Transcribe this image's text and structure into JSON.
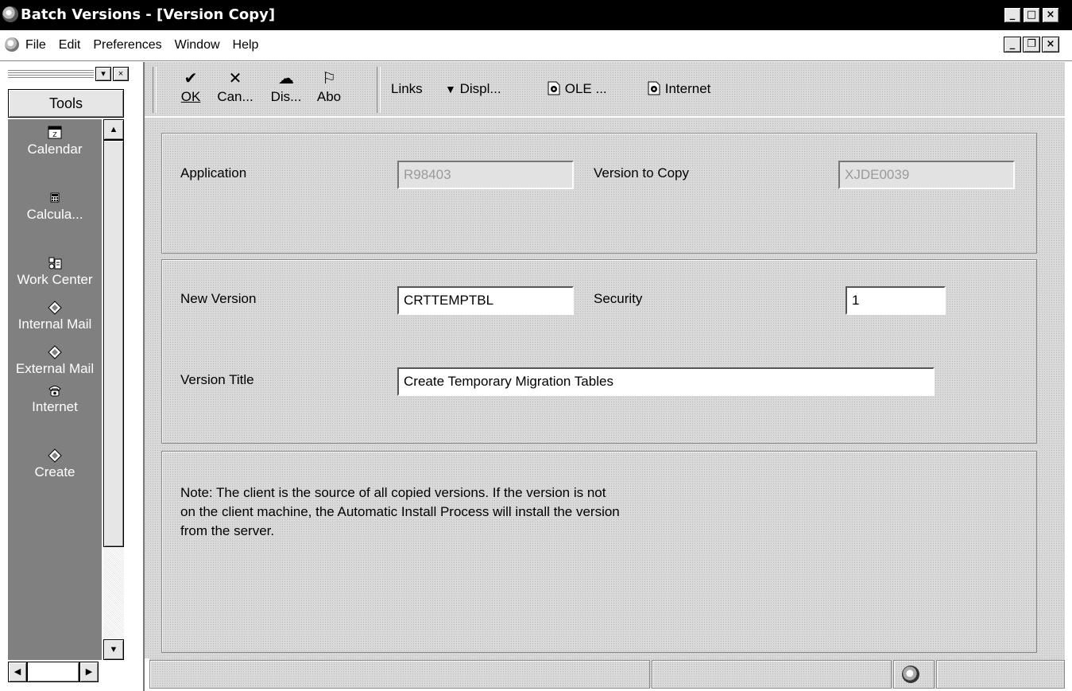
{
  "window": {
    "title": "Batch Versions - [Version Copy]"
  },
  "menu": [
    "File",
    "Edit",
    "Preferences",
    "Window",
    "Help"
  ],
  "tools_pane": {
    "header": "Tools",
    "items": [
      {
        "label": "Calendar",
        "icon": "calendar-icon"
      },
      {
        "label": "Calcula...",
        "icon": "calculator-icon"
      },
      {
        "label": "Work Center",
        "icon": "work-center-icon"
      },
      {
        "label": "Internal Mail",
        "icon": "mail-icon"
      },
      {
        "label": "External Mail",
        "icon": "mail-icon"
      },
      {
        "label": "Internet",
        "icon": "phone-icon"
      },
      {
        "label": "Create",
        "icon": "mail-icon"
      }
    ]
  },
  "toolbar": {
    "ok": "OK",
    "cancel": "Can...",
    "display": "Dis...",
    "about": "Abo",
    "links": "Links",
    "display_menu": "Displ...",
    "ole": "OLE ...",
    "internet": "Internet"
  },
  "form": {
    "application_label": "Application",
    "application_value": "R98403",
    "version_to_copy_label": "Version to Copy",
    "version_to_copy_value": "XJDE0039",
    "new_version_label": "New Version",
    "new_version_value": "CRTTEMPTBL",
    "security_label": "Security",
    "security_value": "1",
    "version_title_label": "Version Title",
    "version_title_value": "Create Temporary Migration Tables",
    "note_lines": [
      "Note: The client is the source of all copied versions.  If the version is not",
      "on the client machine, the Automatic Install Process will install the version",
      "from the server."
    ]
  }
}
